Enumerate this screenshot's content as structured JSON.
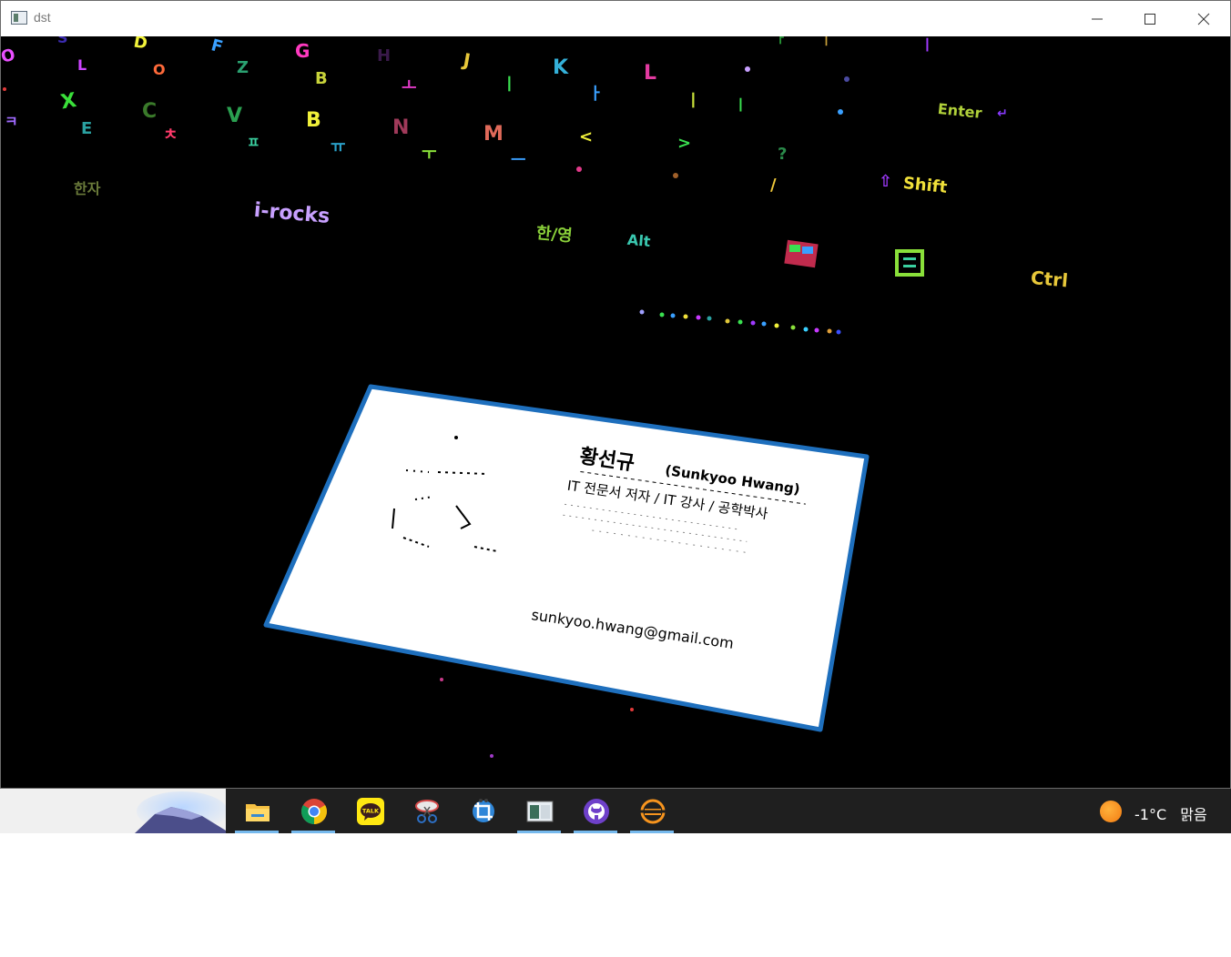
{
  "window": {
    "title": "dst",
    "minimize_glyph": "—",
    "maximize_glyph": "☐",
    "close_glyph": "✕"
  },
  "keyboard_labels": {
    "enter": "Enter",
    "shift": "Shift",
    "alt": "Alt",
    "ctrl": "Ctrl",
    "brand": "i-rocks",
    "hanja": "한/영",
    "hangul_mark": "한자"
  },
  "business_card": {
    "name_korean": "황선규",
    "name_english": "(Sunkyoo Hwang)",
    "roles": "IT 전문서 저자 / IT 강사 / 공학박사",
    "email": "sunkyoo.hwang@gmail.com"
  },
  "taskbar": {
    "apps": [
      {
        "name": "file-explorer",
        "active": true
      },
      {
        "name": "chrome",
        "active": true
      },
      {
        "name": "kakaotalk",
        "active": false
      },
      {
        "name": "snipping-tool",
        "active": false
      },
      {
        "name": "screen-capture",
        "active": false
      },
      {
        "name": "opencv-window",
        "active": true
      },
      {
        "name": "github-desktop",
        "active": true
      },
      {
        "name": "eclipse",
        "active": true
      }
    ],
    "weather": {
      "temperature": "-1°C",
      "condition": "맑음"
    }
  }
}
